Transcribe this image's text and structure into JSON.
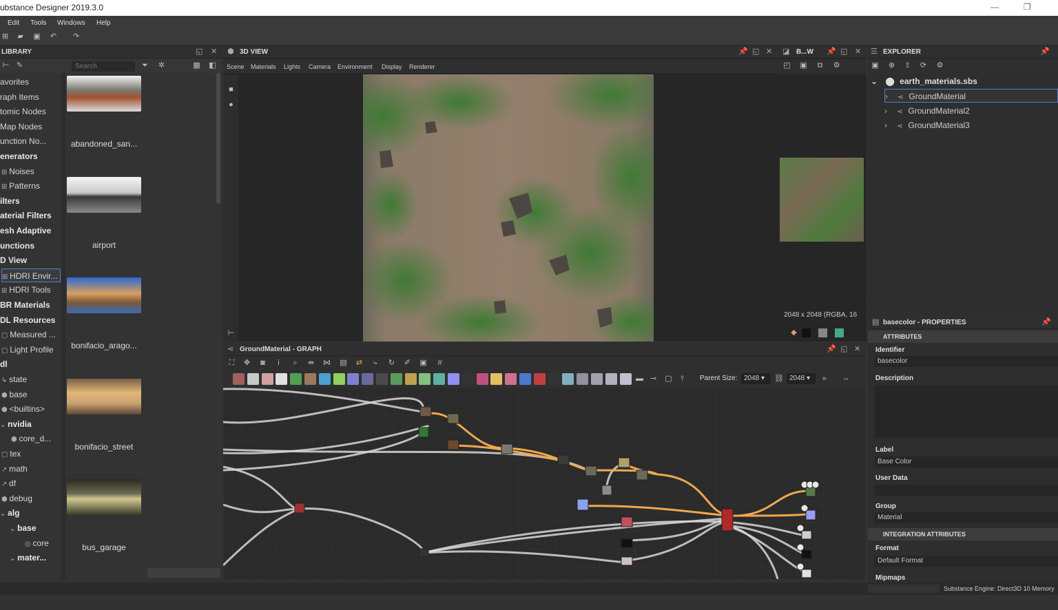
{
  "window": {
    "title": "ubstance Designer 2019.3.0"
  },
  "menu": [
    "Edit",
    "Tools",
    "Windows",
    "Help"
  ],
  "library": {
    "title": "LIBRARY",
    "search_placeholder": "Search",
    "tree": [
      "avorites",
      "raph Items",
      "tomic Nodes",
      "Map Nodes",
      "unction No...",
      "enerators",
      "Noises",
      "Patterns",
      "ilters",
      "aterial Filters",
      "esh Adaptive",
      "unctions",
      "D View",
      "HDRI Envir...",
      "HDRI Tools",
      "BR Materials",
      "DL Resources",
      "Measured ...",
      "Light Profile",
      "dl",
      "state",
      "base",
      "<builtins>",
      "nvidia",
      "core_d...",
      "tex",
      "math",
      "df",
      "debug",
      "alg",
      "base",
      "core",
      "mater..."
    ],
    "thumbs": [
      "abandoned_san...",
      "airport",
      "bonifacio_arago...",
      "bonifacio_street",
      "bus_garage"
    ]
  },
  "view3d": {
    "title": "3D VIEW",
    "menu": [
      "Scene",
      "Materials",
      "Lights",
      "Camera",
      "Environment",
      "Display",
      "Renderer"
    ]
  },
  "bw": {
    "title": "B...W",
    "info": "2048 x 2048 (RGBA, 16"
  },
  "explorer": {
    "title": "EXPLORER",
    "package": "earth_materials.sbs",
    "items": [
      "GroundMaterial",
      "GroundMaterial2",
      "GroundMaterial3"
    ]
  },
  "properties": {
    "title": "basecolor - PROPERTIES",
    "section_attributes": "ATTRIBUTES",
    "identifier_label": "Identifier",
    "identifier_value": "basecolor",
    "description_label": "Description",
    "label_label": "Label",
    "label_value": "Base Color",
    "userdata_label": "User Data",
    "group_label": "Group",
    "group_value": "Material",
    "section_integration": "INTEGRATION ATTRIBUTES",
    "format_label": "Format",
    "format_value": "Default Format",
    "mipmaps_label": "Mipmaps"
  },
  "graph": {
    "title": "GroundMaterial - GRAPH",
    "parent_size_label": "Parent Size:",
    "parent_size_a": "2048",
    "parent_size_b": "2048"
  },
  "status": {
    "text": "Substance Engine: Direct3D 10  Memory"
  },
  "colors": {
    "accent": "#4c7fd8",
    "wire_orange": "#f0a850",
    "wire_white": "#d8d8d8"
  }
}
